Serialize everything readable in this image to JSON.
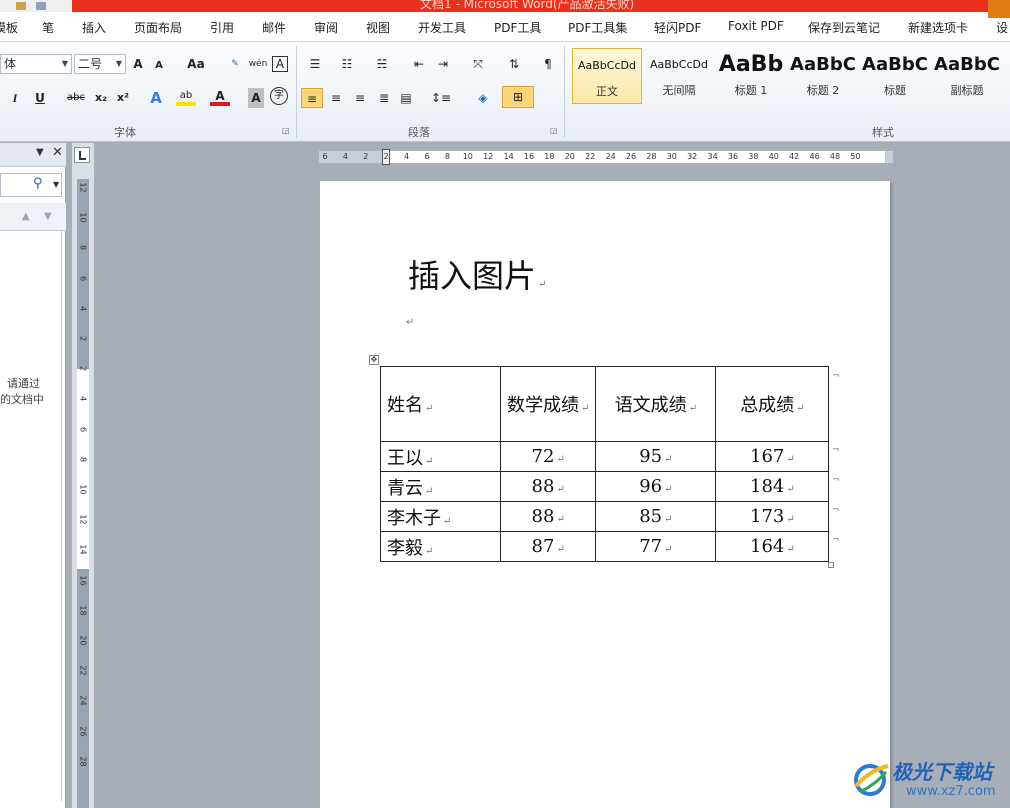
{
  "titlebar": {
    "title": "文档1 - Microsoft Word(产品激活失败)"
  },
  "menu": {
    "items": [
      "模板",
      "笔",
      "插入",
      "页面布局",
      "引用",
      "邮件",
      "审阅",
      "视图",
      "开发工具",
      "PDF工具",
      "PDF工具集",
      "轻闪PDF",
      "Foxit PDF",
      "保存到云笔记",
      "新建选项卡",
      "设"
    ]
  },
  "ribbon": {
    "font": {
      "name": "体",
      "size": "二号",
      "group_label": "字体",
      "grow_label": "A",
      "shrink_label": "A",
      "case_label": "Aa",
      "pinyin_label": "wén",
      "border_char_label": "A",
      "italic_label": "I",
      "underline_label": "U",
      "strike_label": "abc",
      "subscript_label": "x₂",
      "superscript_label": "x²",
      "highlight_label": "ab",
      "fontcolor_label": "A",
      "shading_label": "A",
      "enclose_label": "字"
    },
    "paragraph": {
      "group_label": "段落"
    },
    "styles": {
      "group_label": "样式",
      "tiles": [
        {
          "preview": "AaBbCcDd",
          "name": "正文"
        },
        {
          "preview": "AaBbCcDd",
          "name": "无间隔"
        },
        {
          "preview": "AaBb",
          "name": "标题 1"
        },
        {
          "preview": "AaBbC",
          "name": "标题 2"
        },
        {
          "preview": "AaBbC",
          "name": "标题"
        },
        {
          "preview": "AaBbC",
          "name": "副标题"
        }
      ]
    }
  },
  "navpane": {
    "message_line1": "请通过",
    "message_line2": "的文档中"
  },
  "ruler": {
    "h_ticks": [
      "6",
      "4",
      "2",
      "2",
      "4",
      "6",
      "8",
      "10",
      "12",
      "14",
      "16",
      "18",
      "20",
      "22",
      "24",
      "26",
      "28",
      "30",
      "32",
      "34",
      "36",
      "38",
      "40",
      "42",
      "46",
      "48",
      "50"
    ],
    "v_ticks": [
      "12",
      "10",
      "8",
      "6",
      "4",
      "2",
      "2",
      "4",
      "6",
      "8",
      "10",
      "12",
      "14",
      "16",
      "18",
      "20",
      "22",
      "24",
      "26",
      "28"
    ]
  },
  "document": {
    "title": "插入图片",
    "table": {
      "headers": [
        "姓名",
        "数学成绩",
        "语文成绩",
        "总成绩"
      ],
      "rows": [
        [
          "王以",
          "72",
          "95",
          "167"
        ],
        [
          "青云",
          "88",
          "96",
          "184"
        ],
        [
          "李木子",
          "88",
          "85",
          "173"
        ],
        [
          "李毅",
          "87",
          "77",
          "164"
        ]
      ]
    }
  },
  "watermark": {
    "name": "极光下载站",
    "url": "www.xz7.com"
  }
}
